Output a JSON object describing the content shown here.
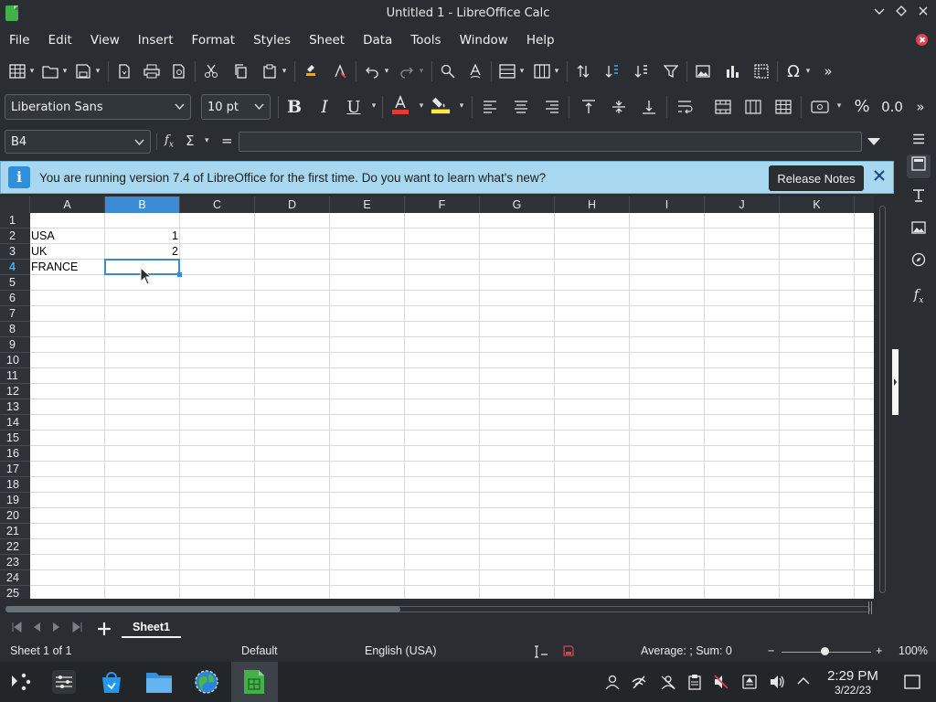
{
  "window": {
    "title": "Untitled 1 - LibreOffice Calc",
    "controls": [
      "minimize",
      "maximize",
      "close"
    ]
  },
  "menubar": {
    "items": [
      "File",
      "Edit",
      "View",
      "Insert",
      "Format",
      "Styles",
      "Sheet",
      "Data",
      "Tools",
      "Window",
      "Help"
    ]
  },
  "formatting": {
    "font_name": "Liberation Sans",
    "font_size": "10 pt",
    "font_color_swatch": "#e53935",
    "highlight_color_swatch": "#ffeb3b"
  },
  "formula_bar": {
    "name_box": "B4",
    "fx_symbol": "fx",
    "sigma_symbol": "Σ",
    "equals_symbol": "=",
    "content": ""
  },
  "info_bar": {
    "message": "You are running version 7.4 of LibreOffice for the first time. Do you want to learn what's new?",
    "button_label": "Release Notes",
    "icon_glyph": "i"
  },
  "sheet": {
    "columns": [
      "A",
      "B",
      "C",
      "D",
      "E",
      "F",
      "G",
      "H",
      "I",
      "J",
      "K"
    ],
    "selected_column": "B",
    "rows": [
      "1",
      "2",
      "3",
      "4",
      "5",
      "6",
      "7",
      "8",
      "9",
      "10",
      "11",
      "12",
      "13",
      "14",
      "15",
      "16",
      "17",
      "18",
      "19",
      "20",
      "21",
      "22",
      "23",
      "24",
      "25"
    ],
    "selected_row": "4",
    "cells": {
      "A2": "USA",
      "A3": "UK",
      "A4": "FRANCE",
      "B2": "1",
      "B3": "2"
    },
    "active_cell": "B4"
  },
  "sheet_tabs": {
    "tabs": [
      "Sheet1"
    ],
    "active": "Sheet1"
  },
  "status_bar": {
    "sheet_position": "Sheet 1 of 1",
    "page_style": "Default",
    "language": "English (USA)",
    "selection_summary": "Average: ; Sum: 0",
    "zoom": "100%",
    "zoom_minus": "−",
    "zoom_plus": "+"
  },
  "taskbar": {
    "time": "2:29 PM",
    "date": "3/22/23"
  },
  "colors": {
    "accent": "#3b8ad4",
    "infobar_bg": "#a7d8f0",
    "window_bg": "#2a2e32"
  }
}
